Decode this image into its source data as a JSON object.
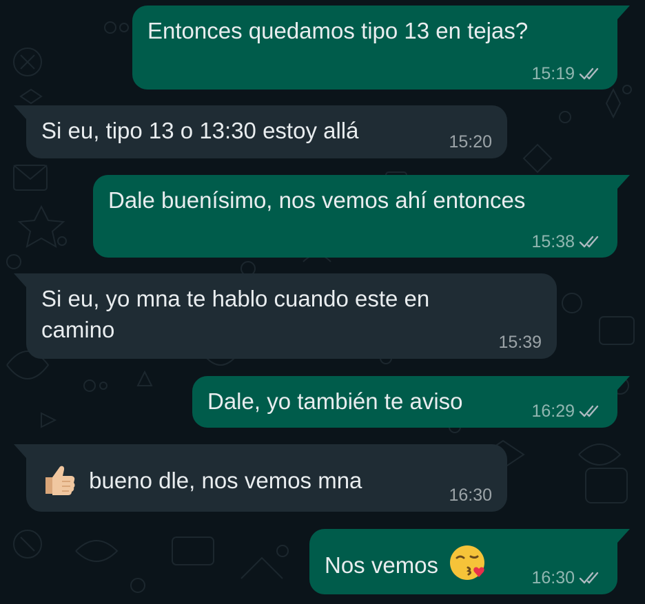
{
  "chat": {
    "colors": {
      "background": "#0b141a",
      "outgoing_bubble": "#005c4b",
      "incoming_bubble": "#1f2c34",
      "timestamp_text": "#9aa5ab"
    },
    "messages": [
      {
        "direction": "outgoing",
        "text": "Entonces quedamos tipo 13 en tejas?",
        "time": "15:19",
        "status": "read-ticks-icon"
      },
      {
        "direction": "incoming",
        "text": "Si eu,  tipo 13 o 13:30 estoy allá",
        "time": "15:20"
      },
      {
        "direction": "outgoing",
        "text": "Dale buenísimo, nos vemos ahí entonces",
        "time": "15:38",
        "status": "read-ticks-icon"
      },
      {
        "direction": "incoming",
        "text_line1": "Si eu,  yo mna te hablo cuando este en",
        "text_line2": "camino",
        "time": "15:39"
      },
      {
        "direction": "outgoing",
        "text": "Dale, yo también te aviso",
        "time": "16:29",
        "status": "read-ticks-icon"
      },
      {
        "direction": "incoming",
        "emoji": "thumbs-up-icon",
        "text": "bueno dle,  nos vemos mna",
        "time": "16:30"
      },
      {
        "direction": "outgoing",
        "text": "Nos vemos",
        "emoji": "kissing-face-icon",
        "time": "16:30",
        "status": "read-ticks-icon"
      }
    ]
  }
}
